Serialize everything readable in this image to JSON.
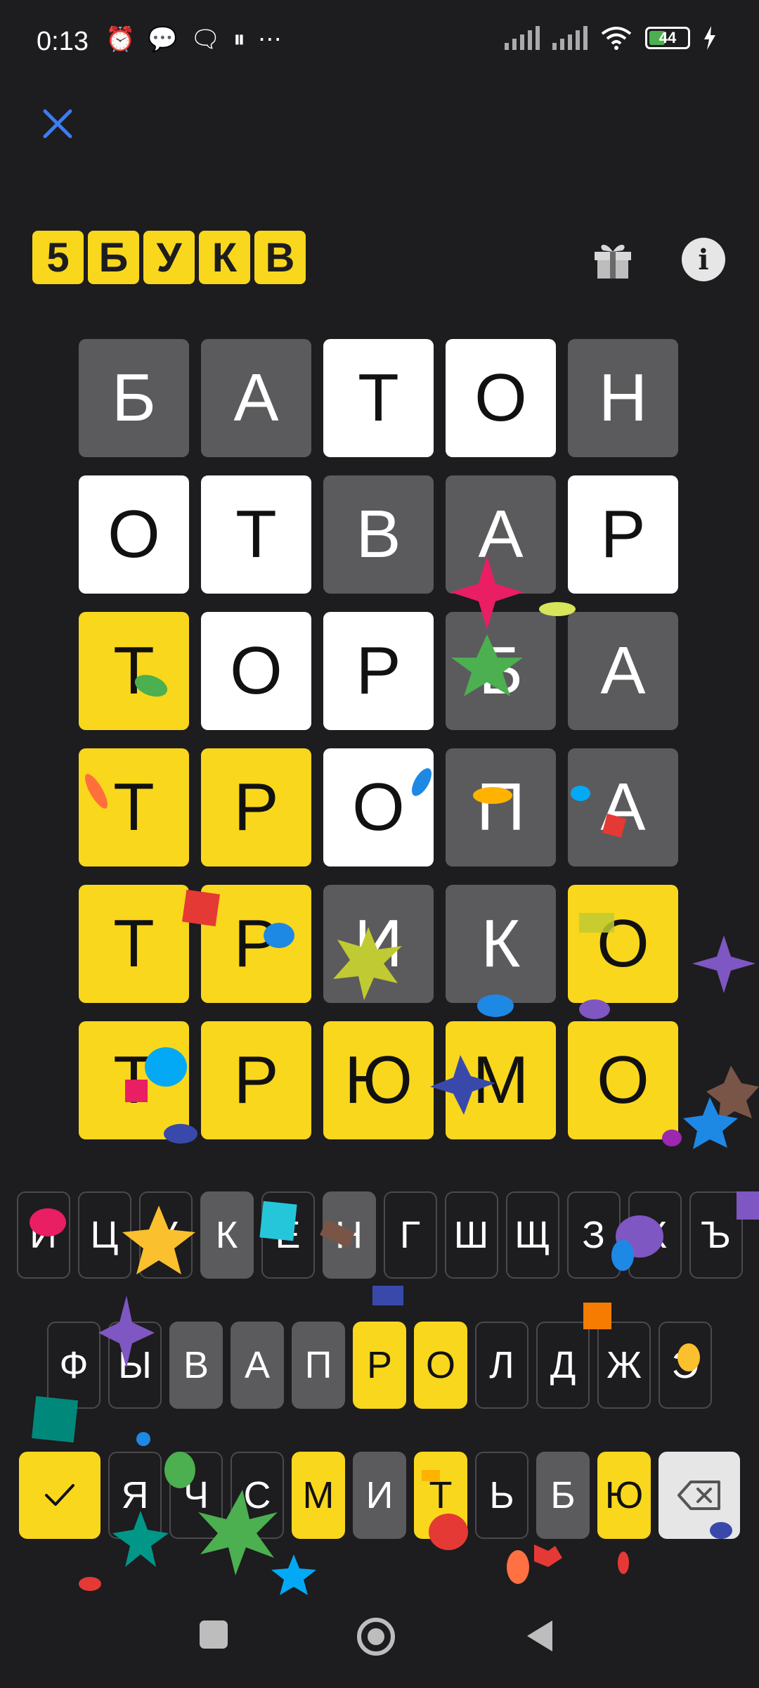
{
  "status_bar": {
    "time": "0:13",
    "battery": "44"
  },
  "logo": [
    "5",
    "Б",
    "У",
    "К",
    "В"
  ],
  "board": [
    [
      {
        "l": "Б",
        "s": "absent"
      },
      {
        "l": "А",
        "s": "absent"
      },
      {
        "l": "Т",
        "s": "present"
      },
      {
        "l": "О",
        "s": "present"
      },
      {
        "l": "Н",
        "s": "absent"
      }
    ],
    [
      {
        "l": "О",
        "s": "present"
      },
      {
        "l": "Т",
        "s": "present"
      },
      {
        "l": "В",
        "s": "absent"
      },
      {
        "l": "А",
        "s": "absent"
      },
      {
        "l": "Р",
        "s": "present"
      }
    ],
    [
      {
        "l": "Т",
        "s": "correct"
      },
      {
        "l": "О",
        "s": "present"
      },
      {
        "l": "Р",
        "s": "present"
      },
      {
        "l": "Б",
        "s": "absent"
      },
      {
        "l": "А",
        "s": "absent"
      }
    ],
    [
      {
        "l": "Т",
        "s": "correct"
      },
      {
        "l": "Р",
        "s": "correct"
      },
      {
        "l": "О",
        "s": "present"
      },
      {
        "l": "П",
        "s": "absent"
      },
      {
        "l": "А",
        "s": "absent"
      }
    ],
    [
      {
        "l": "Т",
        "s": "correct"
      },
      {
        "l": "Р",
        "s": "correct"
      },
      {
        "l": "И",
        "s": "absent"
      },
      {
        "l": "К",
        "s": "absent"
      },
      {
        "l": "О",
        "s": "correct"
      }
    ],
    [
      {
        "l": "Т",
        "s": "correct"
      },
      {
        "l": "Р",
        "s": "correct"
      },
      {
        "l": "Ю",
        "s": "correct"
      },
      {
        "l": "М",
        "s": "correct"
      },
      {
        "l": "О",
        "s": "correct"
      }
    ]
  ],
  "keyboard": {
    "row1": [
      {
        "l": "Й",
        "s": "n"
      },
      {
        "l": "Ц",
        "s": "n"
      },
      {
        "l": "У",
        "s": "n"
      },
      {
        "l": "К",
        "s": "absent"
      },
      {
        "l": "Е",
        "s": "n"
      },
      {
        "l": "Н",
        "s": "absent"
      },
      {
        "l": "Г",
        "s": "n"
      },
      {
        "l": "Ш",
        "s": "n"
      },
      {
        "l": "Щ",
        "s": "n"
      },
      {
        "l": "З",
        "s": "n"
      },
      {
        "l": "Х",
        "s": "n"
      },
      {
        "l": "Ъ",
        "s": "n"
      }
    ],
    "row2": [
      {
        "l": "Ф",
        "s": "n"
      },
      {
        "l": "Ы",
        "s": "n"
      },
      {
        "l": "В",
        "s": "absent"
      },
      {
        "l": "А",
        "s": "absent"
      },
      {
        "l": "П",
        "s": "absent"
      },
      {
        "l": "Р",
        "s": "correct"
      },
      {
        "l": "О",
        "s": "correct"
      },
      {
        "l": "Л",
        "s": "n"
      },
      {
        "l": "Д",
        "s": "n"
      },
      {
        "l": "Ж",
        "s": "n"
      },
      {
        "l": "Э",
        "s": "n"
      }
    ],
    "row3": [
      {
        "l": "Я",
        "s": "n"
      },
      {
        "l": "Ч",
        "s": "n"
      },
      {
        "l": "С",
        "s": "n"
      },
      {
        "l": "М",
        "s": "correct"
      },
      {
        "l": "И",
        "s": "absent"
      },
      {
        "l": "Т",
        "s": "correct"
      },
      {
        "l": "Ь",
        "s": "n"
      },
      {
        "l": "Б",
        "s": "absent"
      },
      {
        "l": "Ю",
        "s": "correct"
      }
    ]
  },
  "colors": {
    "background": "#1d1c1e",
    "correct": "#f9d71c",
    "present": "#ffffff",
    "absent": "#5b5b5d",
    "close_icon": "#3d7cf0"
  },
  "icons": [
    "close-icon",
    "gift-icon",
    "info-icon",
    "check-icon",
    "backspace-icon",
    "nav-square-icon",
    "nav-circle-icon",
    "nav-back-icon"
  ]
}
